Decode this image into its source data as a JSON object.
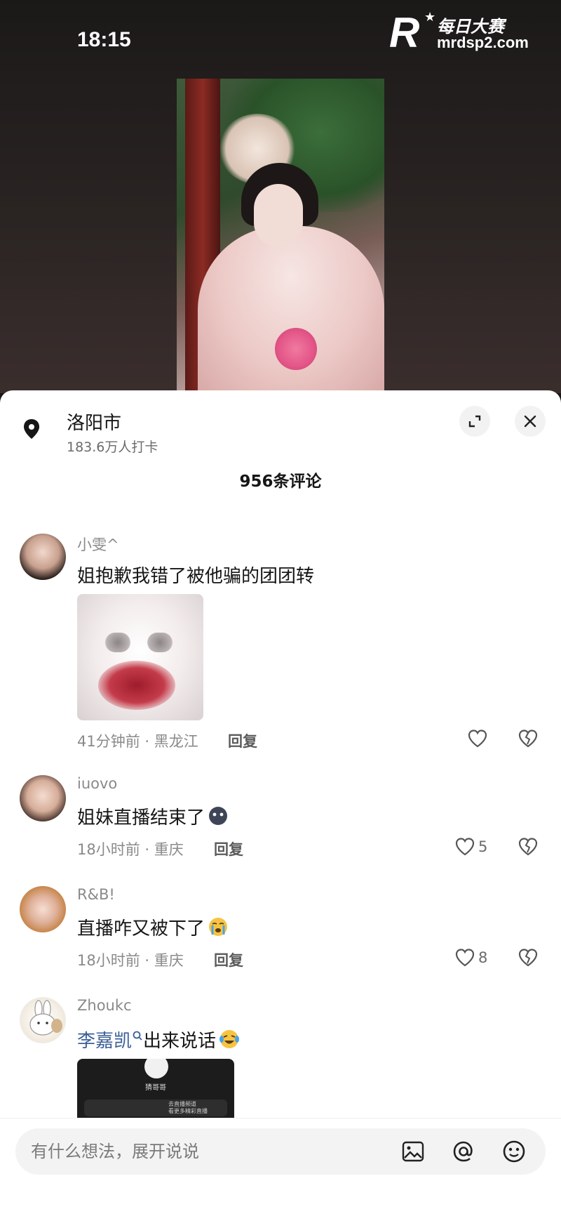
{
  "status_bar": {
    "time": "18:15"
  },
  "watermark": {
    "brand": "每日大赛",
    "url": "mrdsp2.com",
    "logo_letter": "R"
  },
  "location": {
    "name": "洛阳市",
    "checkins": "183.6万人打卡"
  },
  "comments_header": {
    "count_label": "956条评论"
  },
  "comments": [
    {
      "username": "小雯^",
      "text": "姐抱歉我错了被他骗的团团转",
      "time_location": "41分钟前 · 黑龙江",
      "reply_label": "回复",
      "likes": "",
      "has_sticker": true
    },
    {
      "username": "iuovo",
      "text": "姐妹直播结束了",
      "time_location": "18小时前 · 重庆",
      "reply_label": "回复",
      "likes": "5"
    },
    {
      "username": "R&B!",
      "text": "直播咋又被下了",
      "time_location": "18小时前 · 重庆",
      "reply_label": "回复",
      "likes": "8"
    },
    {
      "username": "Zhoukc",
      "mention": "李嘉凯",
      "text": "出来说话",
      "has_screenshot": true,
      "screenshot": {
        "name": "猜哥哥",
        "hint_line1": "去直播频道",
        "hint_line2": "看更多精彩直播"
      }
    }
  ],
  "input": {
    "placeholder": "有什么想法，展开说说"
  },
  "icons": {
    "location": "location-pin-icon",
    "expand": "expand-icon",
    "close": "close-icon",
    "like": "heart-icon",
    "dislike": "broken-heart-icon",
    "image": "image-icon",
    "mention": "at-icon",
    "emoji": "smiley-icon"
  },
  "colors": {
    "mention_link": "#3b5f98",
    "sheet_bg": "#ffffff",
    "muted_text": "#8a8a8a"
  }
}
